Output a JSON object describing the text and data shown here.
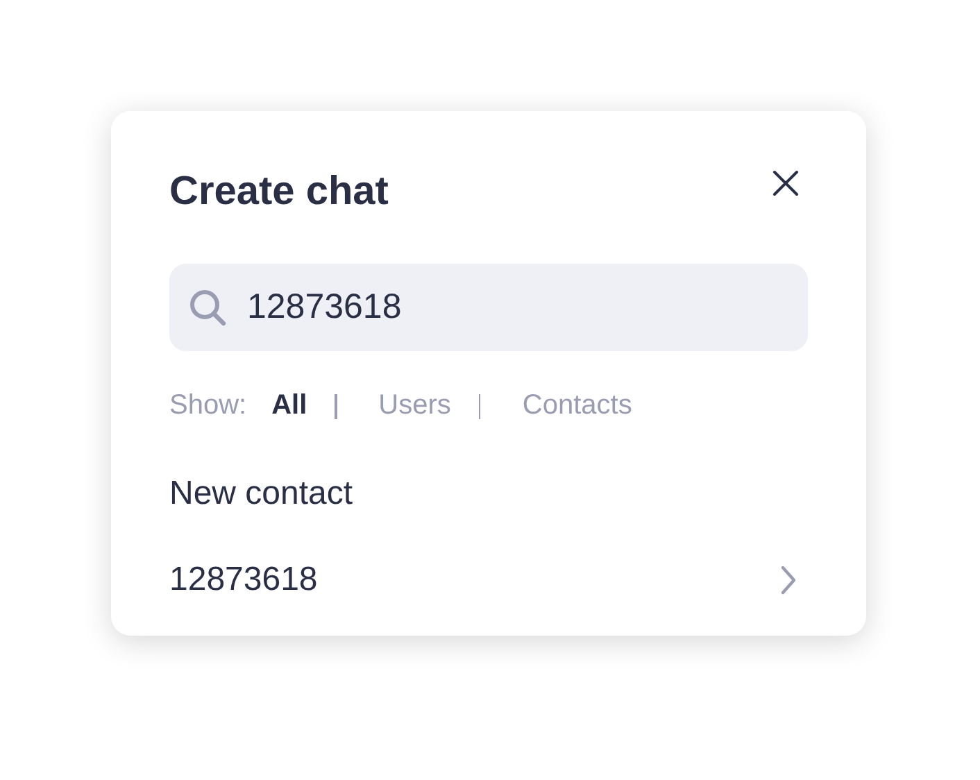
{
  "dialog": {
    "title": "Create chat"
  },
  "search": {
    "value": "12873618"
  },
  "filter": {
    "label": "Show:",
    "options": [
      {
        "label": "All",
        "selected": true
      },
      {
        "label": "Users",
        "selected": false
      },
      {
        "label": "Contacts",
        "selected": false
      }
    ]
  },
  "section_title": "New contact",
  "results": [
    {
      "label": "12873618"
    }
  ]
}
